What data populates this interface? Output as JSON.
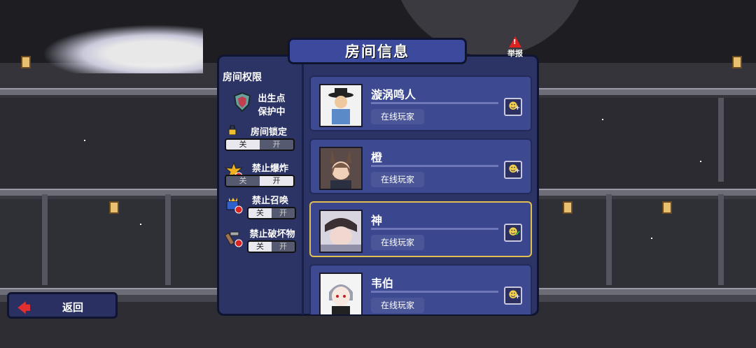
{
  "header": {
    "title": "房间信息",
    "report_label": "举报",
    "report_mark": "!"
  },
  "sidebar": {
    "title": "房间权限",
    "spawn": {
      "label_line1": "出生点",
      "label_line2": "保护中"
    },
    "options": [
      {
        "label": "房间锁定",
        "off": "关",
        "on": "开",
        "state": "off",
        "icon": "lock-icon"
      },
      {
        "label": "禁止爆炸",
        "off": "关",
        "on": "开",
        "state": "on",
        "icon": "explosion-icon"
      },
      {
        "label": "禁止召唤",
        "off": "关",
        "on": "开",
        "state": "off",
        "icon": "summon-icon"
      },
      {
        "label": "禁止破坏物",
        "off": "关",
        "on": "开",
        "state": "off",
        "icon": "destroy-icon"
      }
    ]
  },
  "players": [
    {
      "name": "漩涡鸣人",
      "status": "在线玩家",
      "action": "add-friend",
      "selected": false
    },
    {
      "name": "橙",
      "status": "在线玩家",
      "action": "add-friend",
      "selected": false
    },
    {
      "name": "神",
      "status": "在线玩家",
      "action": "friend-added",
      "selected": true
    },
    {
      "name": "韦伯",
      "status": "在线玩家",
      "action": "add-friend",
      "selected": false
    }
  ],
  "back_button": {
    "label": "返回"
  },
  "colors": {
    "panel": "#2c3466",
    "card": "#3d4a92",
    "selected_border": "#e0c050",
    "accent_red": "#e23030"
  }
}
